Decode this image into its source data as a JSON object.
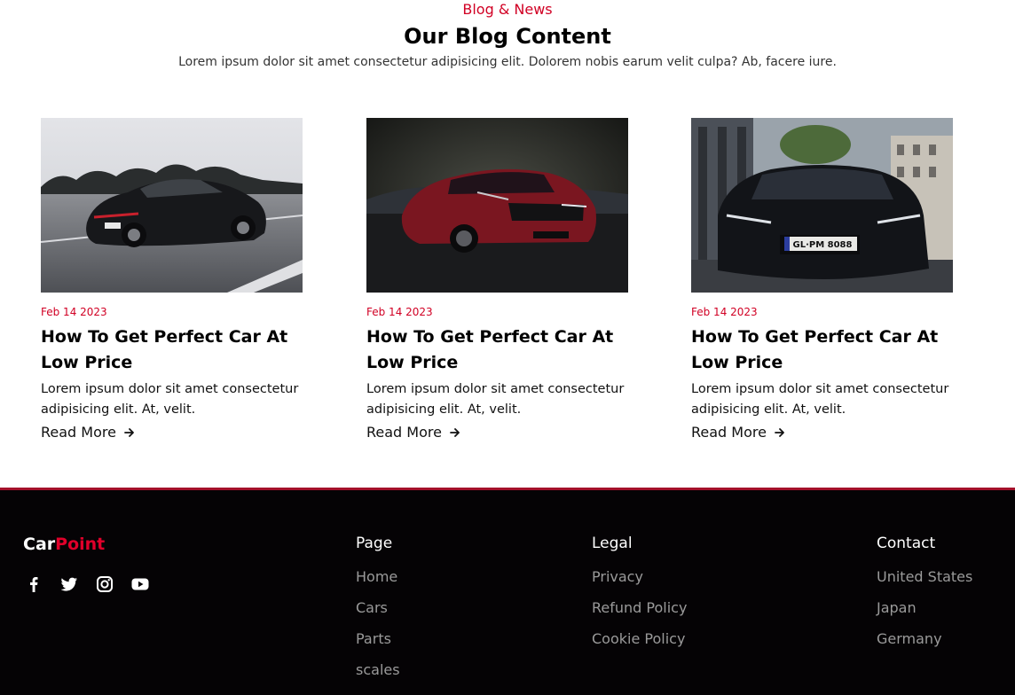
{
  "blog": {
    "eyebrow": "Blog & News",
    "title": "Our Blog Content",
    "subtitle": "Lorem ipsum dolor sit amet consectetur adipisicing elit. Dolorem nobis earum velit culpa? Ab, facere iure.",
    "cards": [
      {
        "date": "Feb 14 2023",
        "title": "How To Get Perfect Car At Low Price",
        "text": "Lorem ipsum dolor sit amet consectetur adipisicing elit. At, velit.",
        "read_more": "Read More"
      },
      {
        "date": "Feb 14 2023",
        "title": "How To Get Perfect Car At Low Price",
        "text": "Lorem ipsum dolor sit amet consectetur adipisicing elit. At, velit.",
        "read_more": "Read More"
      },
      {
        "date": "Feb 14 2023",
        "title": "How To Get Perfect Car At Low Price",
        "text": "Lorem ipsum dolor sit amet consectetur adipisicing elit. At, velit.",
        "read_more": "Read More"
      }
    ]
  },
  "footer": {
    "brand_part1": "Car",
    "brand_part2": "Point",
    "social_icons": [
      "facebook-icon",
      "twitter-icon",
      "instagram-icon",
      "youtube-icon"
    ],
    "page": {
      "title": "Page",
      "links": [
        "Home",
        "Cars",
        "Parts",
        "scales"
      ]
    },
    "legal": {
      "title": "Legal",
      "links": [
        "Privacy",
        "Refund Policy",
        "Cookie Policy"
      ]
    },
    "contact": {
      "title": "Contact",
      "links": [
        "United States",
        "Japan",
        "Germany"
      ]
    }
  },
  "colors": {
    "accent": "#d10024",
    "footer_bg": "#050305",
    "footer_border": "#a3102a",
    "footer_link": "#9a9a9a"
  }
}
